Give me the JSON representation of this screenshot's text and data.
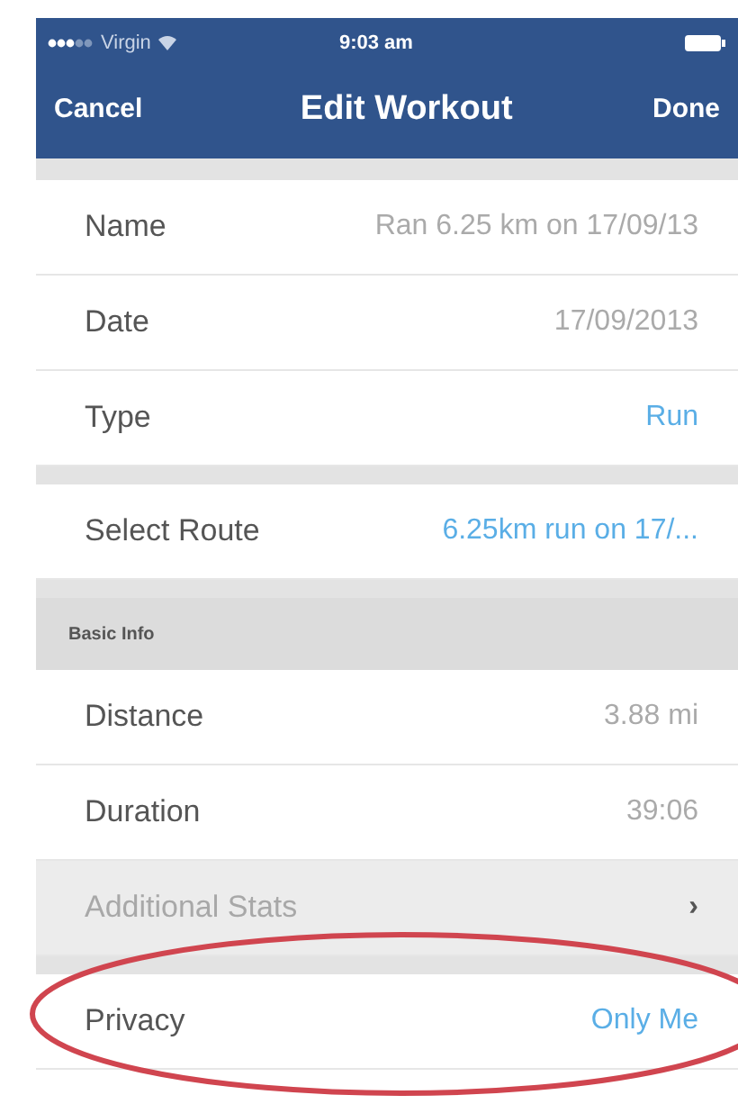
{
  "status_bar": {
    "carrier": "Virgin",
    "time": "9:03 am"
  },
  "nav": {
    "left": "Cancel",
    "title": "Edit Workout",
    "right": "Done"
  },
  "sections": [
    {
      "rows": [
        {
          "label": "Name",
          "value": "Ran 6.25 km on 17/09/13",
          "kind": "plain",
          "disabled": false
        },
        {
          "label": "Date",
          "value": "17/09/2013",
          "kind": "plain",
          "disabled": false
        },
        {
          "label": "Type",
          "value": "Run",
          "kind": "link",
          "disabled": false
        }
      ]
    },
    {
      "rows": [
        {
          "label": "Select Route",
          "value": "6.25km run on 17/...",
          "kind": "link",
          "disabled": false
        }
      ]
    },
    {
      "header": "Basic Info",
      "rows": [
        {
          "label": "Distance",
          "value": "3.88 mi",
          "kind": "plain",
          "disabled": false
        },
        {
          "label": "Duration",
          "value": "39:06",
          "kind": "plain",
          "disabled": false
        },
        {
          "label": "Additional Stats",
          "value": "›",
          "kind": "nav",
          "disabled": true
        }
      ]
    },
    {
      "highlighted": true,
      "rows": [
        {
          "label": "Privacy",
          "value": "Only Me",
          "kind": "link",
          "disabled": false
        }
      ]
    }
  ]
}
